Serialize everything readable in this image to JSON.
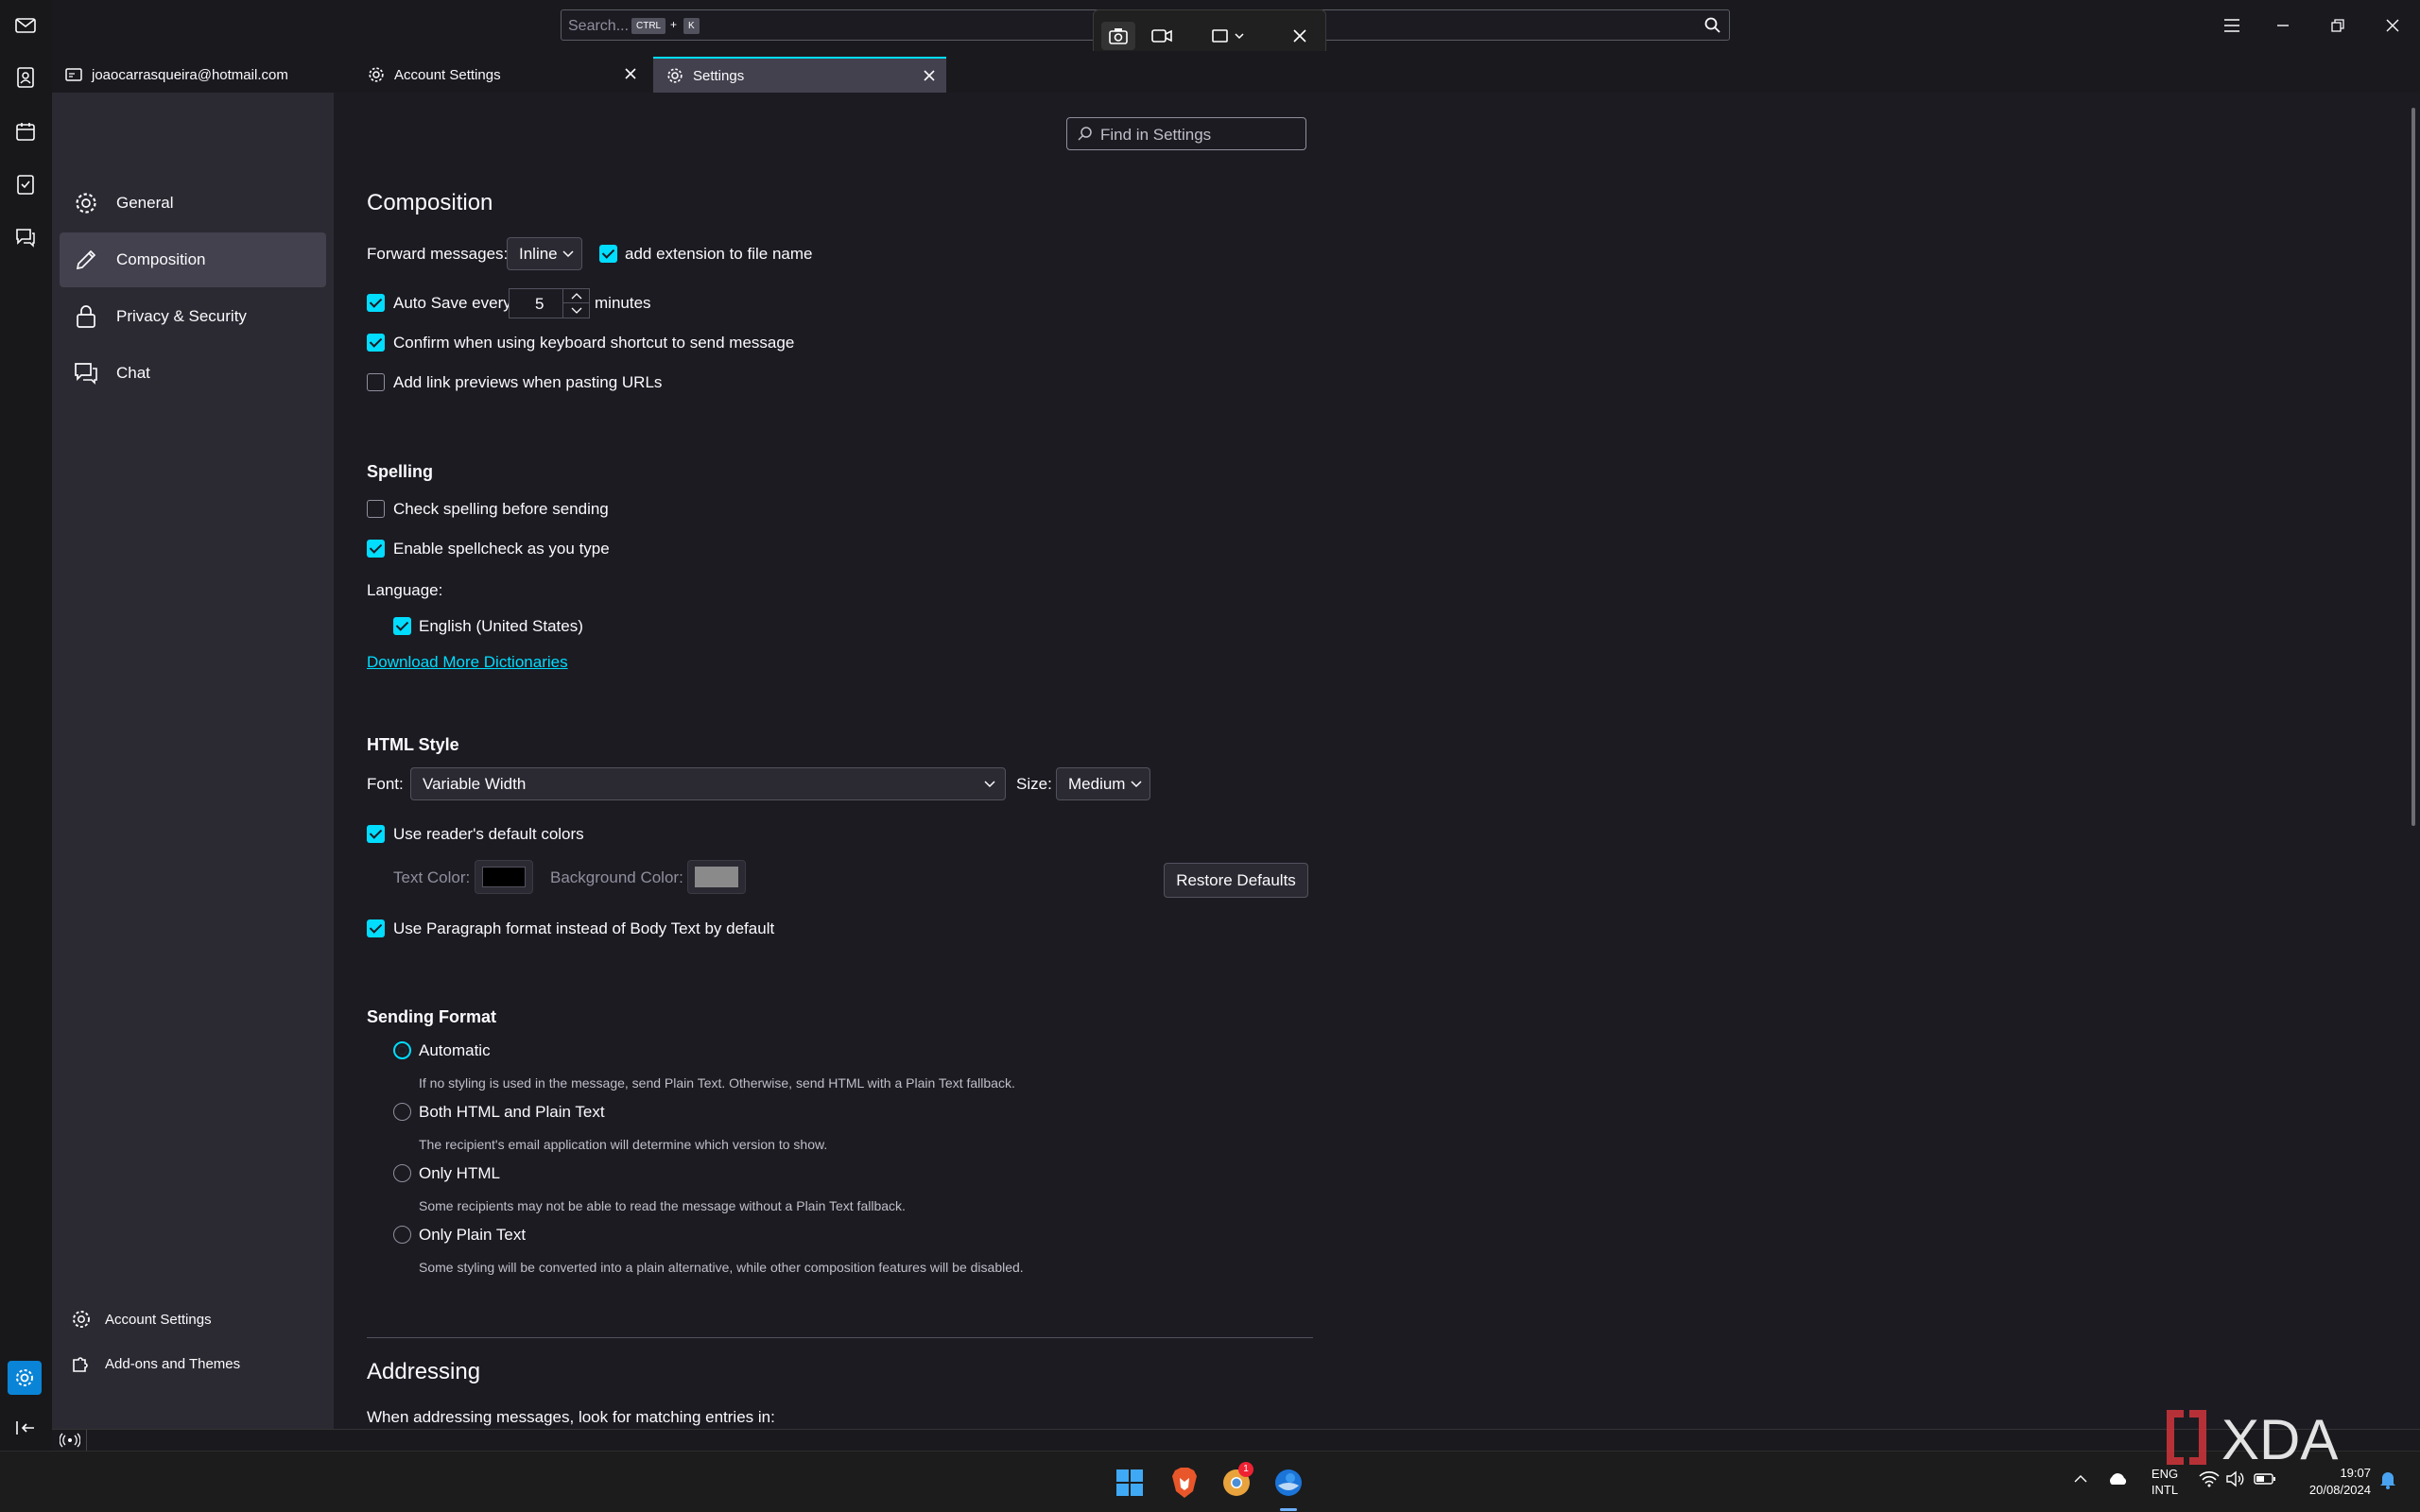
{
  "search": {
    "placeholder": "Search...",
    "key1": "CTRL",
    "plus": "+",
    "key2": "K"
  },
  "tabs": [
    {
      "label": "joaocarrasqueira@hotmail.com"
    },
    {
      "label": "Account Settings"
    },
    {
      "label": "Settings"
    }
  ],
  "sidebar": {
    "categories": [
      {
        "label": "General",
        "icon": "gear-icon"
      },
      {
        "label": "Composition",
        "icon": "pencil-icon",
        "selected": true
      },
      {
        "label": "Privacy & Security",
        "icon": "lock-icon"
      },
      {
        "label": "Chat",
        "icon": "chat-icon"
      }
    ],
    "bottom": [
      {
        "label": "Account Settings",
        "icon": "gear-icon"
      },
      {
        "label": "Add-ons and Themes",
        "icon": "puzzle-icon"
      }
    ]
  },
  "find": {
    "placeholder": "Find in Settings"
  },
  "composition": {
    "title": "Composition",
    "forward_label": "Forward messages:",
    "forward_value": "Inline",
    "add_extension": "add extension to file name",
    "autosave_label": "Auto Save every",
    "autosave_value": "5",
    "autosave_unit": "minutes",
    "confirm_shortcut": "Confirm when using keyboard shortcut to send message",
    "link_previews": "Add link previews when pasting URLs"
  },
  "spelling": {
    "title": "Spelling",
    "check_before": "Check spelling before sending",
    "enable_as_type": "Enable spellcheck as you type",
    "language_label": "Language:",
    "language_item": "English (United States)",
    "download_link": "Download More Dictionaries"
  },
  "html_style": {
    "title": "HTML Style",
    "font_label": "Font:",
    "font_value": "Variable Width",
    "size_label": "Size:",
    "size_value": "Medium",
    "reader_colors": "Use reader's default colors",
    "text_color_label": "Text Color:",
    "bg_color_label": "Background Color:",
    "restore_defaults": "Restore Defaults",
    "paragraph_format": "Use Paragraph format instead of Body Text by default",
    "text_color": "#000000",
    "bg_color": "#8a8a8a"
  },
  "sending_format": {
    "title": "Sending Format",
    "options": [
      {
        "label": "Automatic",
        "desc": "If no styling is used in the message, send Plain Text. Otherwise, send HTML with a Plain Text fallback.",
        "selected": true
      },
      {
        "label": "Both HTML and Plain Text",
        "desc": "The recipient's email application will determine which version to show."
      },
      {
        "label": "Only HTML",
        "desc": "Some recipients may not be able to read the message without a Plain Text fallback."
      },
      {
        "label": "Only Plain Text",
        "desc": "Some styling will be converted into a plain alternative, while other composition features will be disabled."
      }
    ]
  },
  "addressing": {
    "title": "Addressing",
    "subtitle": "When addressing messages, look for matching entries in:"
  },
  "taskbar": {
    "lang1": "ENG",
    "lang2": "INTL",
    "time": "19:07",
    "date": "20/08/2024",
    "badge": "1"
  },
  "watermark": "XDA",
  "colors": {
    "accent": "#00ddff",
    "sidebar": "#2b2a33",
    "content": "#1c1b22"
  }
}
